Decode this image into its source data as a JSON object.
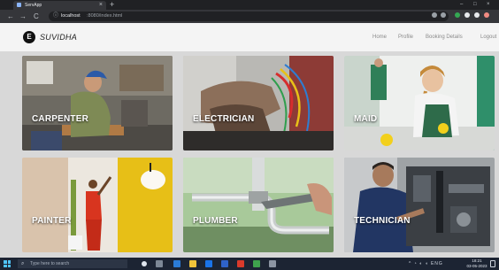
{
  "browser": {
    "tab_title": "ServApp",
    "tab_close": "×",
    "new_tab": "+",
    "window_controls": [
      "–",
      "□",
      "×"
    ],
    "nav_back": "←",
    "nav_forward": "→",
    "nav_reload": "C",
    "url_host": "localhost",
    "url_path": ":8080/index.html"
  },
  "header": {
    "logo_letter": "E",
    "brand": "SUVIDHA",
    "nav": [
      "Home",
      "Profile",
      "Booking Details",
      "Logout"
    ]
  },
  "services": [
    {
      "label": "CARPENTER",
      "icon": "carpenter-photo"
    },
    {
      "label": "ELECTRICIAN",
      "icon": "electrician-photo"
    },
    {
      "label": "MAID",
      "icon": "maid-photo"
    },
    {
      "label": "PAINTER",
      "icon": "painter-photo"
    },
    {
      "label": "PLUMBER",
      "icon": "plumber-photo"
    },
    {
      "label": "TECHNICIAN",
      "icon": "technician-photo"
    }
  ],
  "taskbar": {
    "search_placeholder": "Type here to search",
    "search_glyph": "⌕",
    "tray_glyphs": "^ ◔ ◐ ◖ ENG",
    "clock_time": "18:21",
    "clock_date": "03-05-2023"
  },
  "colors": {
    "browser_dark": "#202124",
    "browser_toolbar": "#35363a",
    "site_header": "#f4f4f4",
    "content_bg": "#d8d8d8",
    "taskbar": "#1c2433"
  }
}
